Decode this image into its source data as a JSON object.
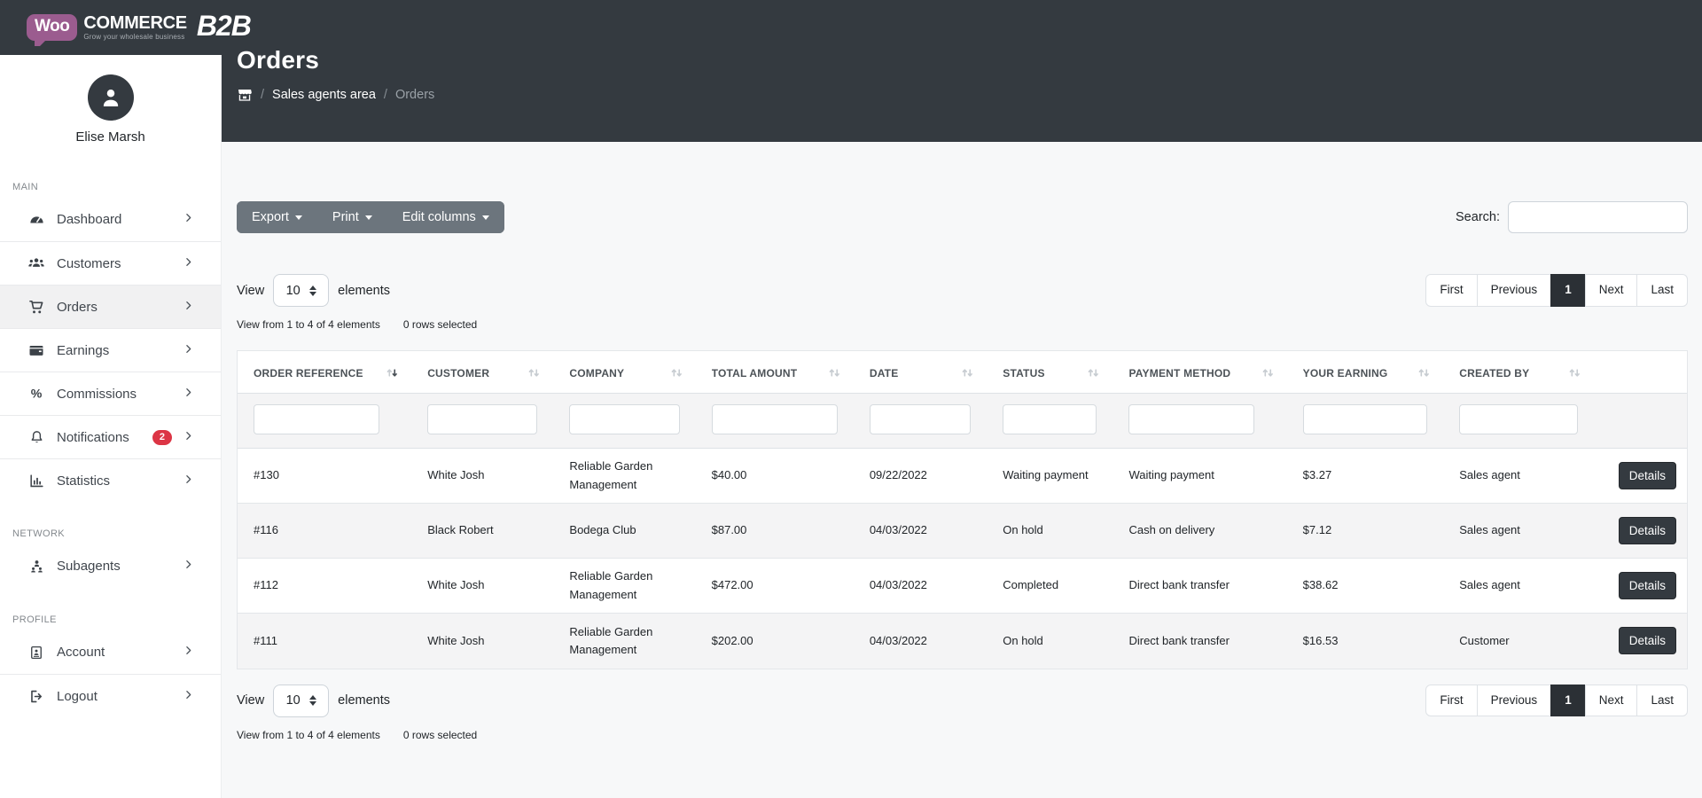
{
  "brand": {
    "woo": "Woo",
    "commerce": "COMMERCE",
    "tagline": "Grow your wholesale business",
    "b2b": "B2B"
  },
  "user": {
    "name": "Elise Marsh"
  },
  "header": {
    "title": "Orders",
    "breadcrumb": {
      "sep": "/",
      "home_icon": "store-icon",
      "level1": "Sales agents area",
      "current": "Orders"
    }
  },
  "sidebar": {
    "sections": {
      "main": {
        "label": "MAIN"
      },
      "network": {
        "label": "NETWORK"
      },
      "profile": {
        "label": "PROFILE"
      }
    },
    "items": {
      "dashboard": {
        "label": "Dashboard",
        "icon": "gauge-icon"
      },
      "customers": {
        "label": "Customers",
        "icon": "users-icon"
      },
      "orders": {
        "label": "Orders",
        "icon": "cart-icon"
      },
      "earnings": {
        "label": "Earnings",
        "icon": "wallet-icon"
      },
      "commissions": {
        "label": "Commissions",
        "icon": "percent-icon"
      },
      "notifications": {
        "label": "Notifications",
        "icon": "bell-icon",
        "badge": "2"
      },
      "statistics": {
        "label": "Statistics",
        "icon": "chart-icon"
      },
      "subagents": {
        "label": "Subagents",
        "icon": "subagents-icon"
      },
      "account": {
        "label": "Account",
        "icon": "id-card-icon"
      },
      "logout": {
        "label": "Logout",
        "icon": "logout-icon"
      }
    }
  },
  "toolbar": {
    "export_label": "Export",
    "print_label": "Print",
    "edit_columns_label": "Edit columns",
    "search_label": "Search:",
    "search_value": ""
  },
  "length_control": {
    "prefix": "View",
    "value": "10",
    "suffix": "elements"
  },
  "info": {
    "summary": "View from 1 to 4 of 4 elements",
    "selected": "0 rows selected"
  },
  "pagination": {
    "first": "First",
    "previous": "Previous",
    "page": "1",
    "next": "Next",
    "last": "Last"
  },
  "table": {
    "details_label": "Details",
    "columns": [
      {
        "label": "ORDER REFERENCE",
        "sort": "desc"
      },
      {
        "label": "CUSTOMER",
        "sort": "both"
      },
      {
        "label": "COMPANY",
        "sort": "both"
      },
      {
        "label": "TOTAL AMOUNT",
        "sort": "both"
      },
      {
        "label": "DATE",
        "sort": "both"
      },
      {
        "label": "STATUS",
        "sort": "both"
      },
      {
        "label": "PAYMENT METHOD",
        "sort": "both"
      },
      {
        "label": "YOUR EARNING",
        "sort": "both"
      },
      {
        "label": "CREATED BY",
        "sort": "both"
      },
      {
        "label": "",
        "sort": null
      }
    ],
    "rows": [
      [
        "#130",
        "White Josh",
        "Reliable Garden Management",
        "$40.00",
        "09/22/2022",
        "Waiting payment",
        "Waiting payment",
        "$3.27",
        "Sales agent"
      ],
      [
        "#116",
        "Black Robert",
        "Bodega Club",
        "$87.00",
        "04/03/2022",
        "On hold",
        "Cash on delivery",
        "$7.12",
        "Sales agent"
      ],
      [
        "#112",
        "White Josh",
        "Reliable Garden Management",
        "$472.00",
        "04/03/2022",
        "Completed",
        "Direct bank transfer",
        "$38.62",
        "Sales agent"
      ],
      [
        "#111",
        "White Josh",
        "Reliable Garden Management",
        "$202.00",
        "04/03/2022",
        "On hold",
        "Direct bank transfer",
        "$16.53",
        "Customer"
      ]
    ]
  },
  "colors": {
    "dark": "#343a40",
    "secondary_button": "#6c757d",
    "brand_purple": "#9b5c8f",
    "badge_red": "#dc3545",
    "stripe": "#f4f4f5"
  }
}
